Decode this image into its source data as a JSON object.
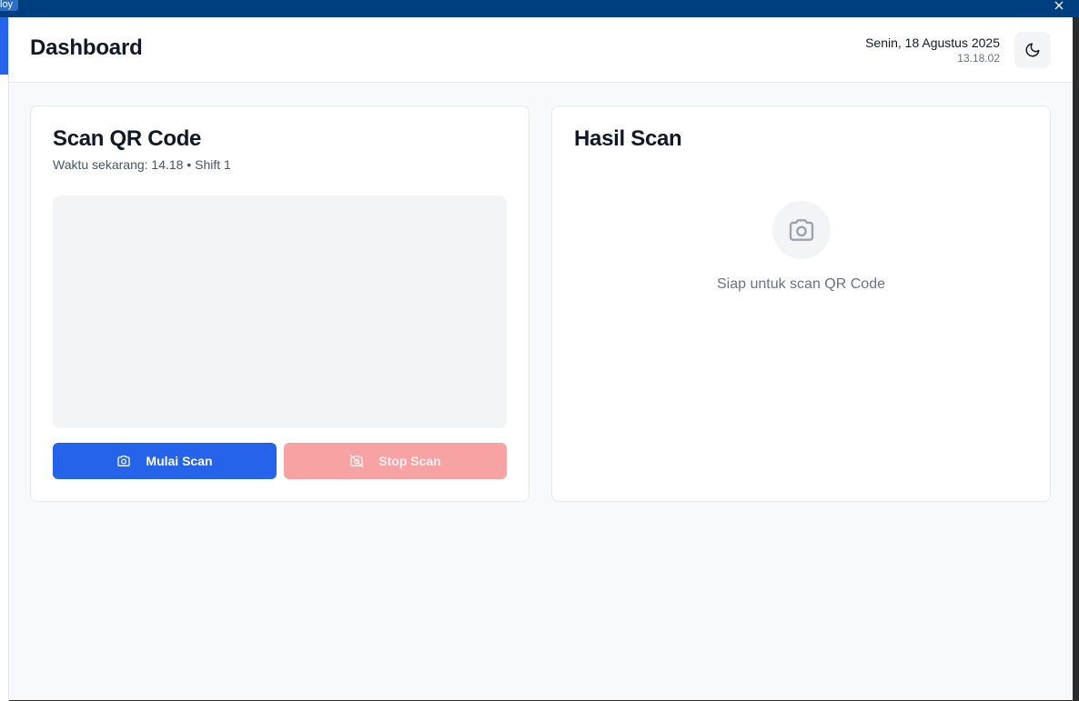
{
  "topbar": {
    "tab_label": "loy",
    "close_icon": "close-icon"
  },
  "header": {
    "title": "Dashboard",
    "date": "Senin, 18 Agustus 2025",
    "time": "13.18.02",
    "theme_toggle_icon": "moon-icon"
  },
  "scan_card": {
    "title": "Scan QR Code",
    "subtitle": "Waktu sekarang: 14.18 • Shift 1",
    "start_button": {
      "label": "Mulai Scan",
      "icon": "camera-icon"
    },
    "stop_button": {
      "label": "Stop Scan",
      "icon": "camera-off-icon"
    }
  },
  "result_card": {
    "title": "Hasil Scan",
    "icon": "camera-icon",
    "empty_text": "Siap untuk scan QR Code"
  },
  "colors": {
    "topbar": "#003f7f",
    "primary": "#2563eb",
    "stop_disabled": "#f8a3a3",
    "background": "#f8f9fb"
  }
}
